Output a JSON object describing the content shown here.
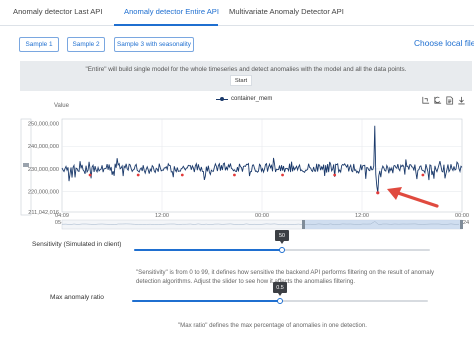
{
  "tabs": [
    {
      "label": "Anomaly detector Last API",
      "active": false
    },
    {
      "label": "Anomaly detector Entire API",
      "active": true
    },
    {
      "label": "Multivariate Anomaly Detector API",
      "active": false
    }
  ],
  "samples": [
    "Sample 1",
    "Sample 2",
    "Sample 3 with seasonality"
  ],
  "choose_file_label": "Choose local file",
  "info": {
    "text": "\"Entire\" will build single model for the whole timeseries and detect anomalies with the model and all the data points.",
    "start_label": "Start"
  },
  "chart": {
    "value_label": "Value",
    "legend": "container_mem",
    "toolbar_icons": [
      "zoom-icon",
      "zoom-reset-icon",
      "data-view-icon",
      "download-icon"
    ]
  },
  "chart_data": {
    "type": "line",
    "series": [
      {
        "name": "container_mem",
        "color": "#1b3a6b"
      }
    ],
    "anomaly_color": "#e23b3b",
    "y_ticks": [
      "250,000,000",
      "240,000,000",
      "230,000,000",
      "220,000,000",
      "211,042,016"
    ],
    "ylim": [
      211042016,
      252000000
    ],
    "x_ticks": [
      {
        "top": "04:09",
        "bottom": "05-22"
      },
      {
        "top": "12:00",
        "bottom": "05-22"
      },
      {
        "top": "00:00",
        "bottom": "05-23"
      },
      {
        "top": "12:00",
        "bottom": "05-23"
      },
      {
        "top": "00:00",
        "bottom": "05-24"
      }
    ],
    "baseline_range": [
      227000000,
      234000000
    ],
    "notable_points": [
      {
        "label": "dip",
        "value": 219500000
      },
      {
        "label": "spike",
        "value": 249000000
      }
    ],
    "grid": true,
    "legend_position": "top-center"
  },
  "sensitivity": {
    "label": "Sensitivity (Simulated in client)",
    "value": "50",
    "fraction": 0.5,
    "description": "\"Sensitivity\" is from 0 to 99, it defines how sensitive the backend API performs filtering on the result of anomaly detection algorithms. Adjust the slider to see how it affects the anomalies filtering."
  },
  "max_ratio": {
    "label": "Max anomaly ratio",
    "value": "0.5",
    "fraction": 0.5,
    "description": "\"Max ratio\" defines the max percentage of anomalies in one detection."
  }
}
